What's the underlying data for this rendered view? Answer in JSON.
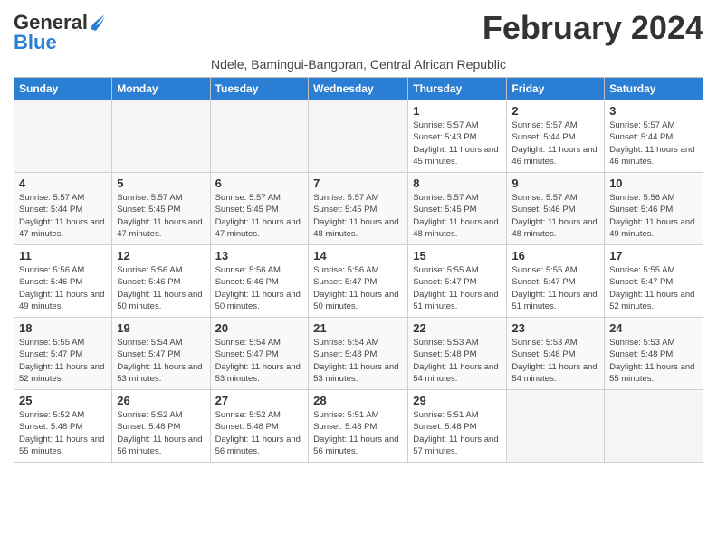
{
  "logo": {
    "text_general": "General",
    "text_blue": "Blue"
  },
  "title": "February 2024",
  "subtitle": "Ndele, Bamingui-Bangoran, Central African Republic",
  "days_of_week": [
    "Sunday",
    "Monday",
    "Tuesday",
    "Wednesday",
    "Thursday",
    "Friday",
    "Saturday"
  ],
  "weeks": [
    [
      {
        "day": "",
        "sunrise": "",
        "sunset": "",
        "daylight": "",
        "empty": true
      },
      {
        "day": "",
        "sunrise": "",
        "sunset": "",
        "daylight": "",
        "empty": true
      },
      {
        "day": "",
        "sunrise": "",
        "sunset": "",
        "daylight": "",
        "empty": true
      },
      {
        "day": "",
        "sunrise": "",
        "sunset": "",
        "daylight": "",
        "empty": true
      },
      {
        "day": "1",
        "sunrise": "Sunrise: 5:57 AM",
        "sunset": "Sunset: 5:43 PM",
        "daylight": "Daylight: 11 hours and 45 minutes.",
        "empty": false
      },
      {
        "day": "2",
        "sunrise": "Sunrise: 5:57 AM",
        "sunset": "Sunset: 5:44 PM",
        "daylight": "Daylight: 11 hours and 46 minutes.",
        "empty": false
      },
      {
        "day": "3",
        "sunrise": "Sunrise: 5:57 AM",
        "sunset": "Sunset: 5:44 PM",
        "daylight": "Daylight: 11 hours and 46 minutes.",
        "empty": false
      }
    ],
    [
      {
        "day": "4",
        "sunrise": "Sunrise: 5:57 AM",
        "sunset": "Sunset: 5:44 PM",
        "daylight": "Daylight: 11 hours and 47 minutes.",
        "empty": false
      },
      {
        "day": "5",
        "sunrise": "Sunrise: 5:57 AM",
        "sunset": "Sunset: 5:45 PM",
        "daylight": "Daylight: 11 hours and 47 minutes.",
        "empty": false
      },
      {
        "day": "6",
        "sunrise": "Sunrise: 5:57 AM",
        "sunset": "Sunset: 5:45 PM",
        "daylight": "Daylight: 11 hours and 47 minutes.",
        "empty": false
      },
      {
        "day": "7",
        "sunrise": "Sunrise: 5:57 AM",
        "sunset": "Sunset: 5:45 PM",
        "daylight": "Daylight: 11 hours and 48 minutes.",
        "empty": false
      },
      {
        "day": "8",
        "sunrise": "Sunrise: 5:57 AM",
        "sunset": "Sunset: 5:45 PM",
        "daylight": "Daylight: 11 hours and 48 minutes.",
        "empty": false
      },
      {
        "day": "9",
        "sunrise": "Sunrise: 5:57 AM",
        "sunset": "Sunset: 5:46 PM",
        "daylight": "Daylight: 11 hours and 48 minutes.",
        "empty": false
      },
      {
        "day": "10",
        "sunrise": "Sunrise: 5:56 AM",
        "sunset": "Sunset: 5:46 PM",
        "daylight": "Daylight: 11 hours and 49 minutes.",
        "empty": false
      }
    ],
    [
      {
        "day": "11",
        "sunrise": "Sunrise: 5:56 AM",
        "sunset": "Sunset: 5:46 PM",
        "daylight": "Daylight: 11 hours and 49 minutes.",
        "empty": false
      },
      {
        "day": "12",
        "sunrise": "Sunrise: 5:56 AM",
        "sunset": "Sunset: 5:46 PM",
        "daylight": "Daylight: 11 hours and 50 minutes.",
        "empty": false
      },
      {
        "day": "13",
        "sunrise": "Sunrise: 5:56 AM",
        "sunset": "Sunset: 5:46 PM",
        "daylight": "Daylight: 11 hours and 50 minutes.",
        "empty": false
      },
      {
        "day": "14",
        "sunrise": "Sunrise: 5:56 AM",
        "sunset": "Sunset: 5:47 PM",
        "daylight": "Daylight: 11 hours and 50 minutes.",
        "empty": false
      },
      {
        "day": "15",
        "sunrise": "Sunrise: 5:55 AM",
        "sunset": "Sunset: 5:47 PM",
        "daylight": "Daylight: 11 hours and 51 minutes.",
        "empty": false
      },
      {
        "day": "16",
        "sunrise": "Sunrise: 5:55 AM",
        "sunset": "Sunset: 5:47 PM",
        "daylight": "Daylight: 11 hours and 51 minutes.",
        "empty": false
      },
      {
        "day": "17",
        "sunrise": "Sunrise: 5:55 AM",
        "sunset": "Sunset: 5:47 PM",
        "daylight": "Daylight: 11 hours and 52 minutes.",
        "empty": false
      }
    ],
    [
      {
        "day": "18",
        "sunrise": "Sunrise: 5:55 AM",
        "sunset": "Sunset: 5:47 PM",
        "daylight": "Daylight: 11 hours and 52 minutes.",
        "empty": false
      },
      {
        "day": "19",
        "sunrise": "Sunrise: 5:54 AM",
        "sunset": "Sunset: 5:47 PM",
        "daylight": "Daylight: 11 hours and 53 minutes.",
        "empty": false
      },
      {
        "day": "20",
        "sunrise": "Sunrise: 5:54 AM",
        "sunset": "Sunset: 5:47 PM",
        "daylight": "Daylight: 11 hours and 53 minutes.",
        "empty": false
      },
      {
        "day": "21",
        "sunrise": "Sunrise: 5:54 AM",
        "sunset": "Sunset: 5:48 PM",
        "daylight": "Daylight: 11 hours and 53 minutes.",
        "empty": false
      },
      {
        "day": "22",
        "sunrise": "Sunrise: 5:53 AM",
        "sunset": "Sunset: 5:48 PM",
        "daylight": "Daylight: 11 hours and 54 minutes.",
        "empty": false
      },
      {
        "day": "23",
        "sunrise": "Sunrise: 5:53 AM",
        "sunset": "Sunset: 5:48 PM",
        "daylight": "Daylight: 11 hours and 54 minutes.",
        "empty": false
      },
      {
        "day": "24",
        "sunrise": "Sunrise: 5:53 AM",
        "sunset": "Sunset: 5:48 PM",
        "daylight": "Daylight: 11 hours and 55 minutes.",
        "empty": false
      }
    ],
    [
      {
        "day": "25",
        "sunrise": "Sunrise: 5:52 AM",
        "sunset": "Sunset: 5:48 PM",
        "daylight": "Daylight: 11 hours and 55 minutes.",
        "empty": false
      },
      {
        "day": "26",
        "sunrise": "Sunrise: 5:52 AM",
        "sunset": "Sunset: 5:48 PM",
        "daylight": "Daylight: 11 hours and 56 minutes.",
        "empty": false
      },
      {
        "day": "27",
        "sunrise": "Sunrise: 5:52 AM",
        "sunset": "Sunset: 5:48 PM",
        "daylight": "Daylight: 11 hours and 56 minutes.",
        "empty": false
      },
      {
        "day": "28",
        "sunrise": "Sunrise: 5:51 AM",
        "sunset": "Sunset: 5:48 PM",
        "daylight": "Daylight: 11 hours and 56 minutes.",
        "empty": false
      },
      {
        "day": "29",
        "sunrise": "Sunrise: 5:51 AM",
        "sunset": "Sunset: 5:48 PM",
        "daylight": "Daylight: 11 hours and 57 minutes.",
        "empty": false
      },
      {
        "day": "",
        "sunrise": "",
        "sunset": "",
        "daylight": "",
        "empty": true
      },
      {
        "day": "",
        "sunrise": "",
        "sunset": "",
        "daylight": "",
        "empty": true
      }
    ]
  ]
}
